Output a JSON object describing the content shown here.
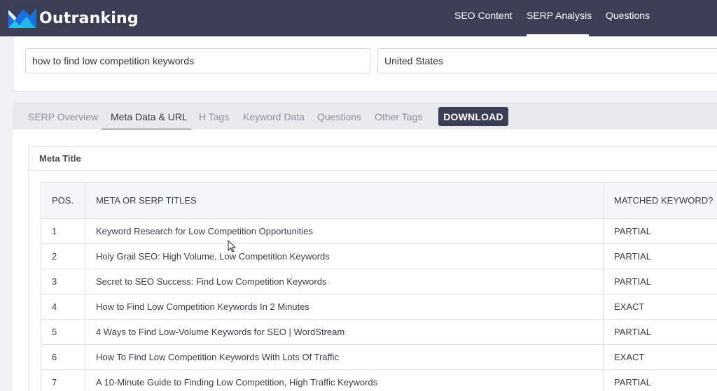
{
  "app": {
    "brand": "Outranking",
    "colors": {
      "header_bg": "#3b3f55",
      "logo_cyan": "#23c4e8",
      "logo_blue": "#1d6fe0"
    }
  },
  "nav": {
    "items": [
      {
        "label": "SEO Content",
        "active": false
      },
      {
        "label": "SERP Analysis",
        "active": true
      },
      {
        "label": "Questions",
        "active": false
      }
    ]
  },
  "search": {
    "keyword_value": "how to find low competition keywords",
    "country_value": "United States"
  },
  "tabs": {
    "items": [
      {
        "label": "SERP Overview",
        "active": false
      },
      {
        "label": "Meta Data & URL",
        "active": true
      },
      {
        "label": "H Tags",
        "active": false
      },
      {
        "label": "Keyword Data",
        "active": false
      },
      {
        "label": "Questions",
        "active": false
      },
      {
        "label": "Other Tags",
        "active": false
      }
    ],
    "download_label": "DOWNLOAD"
  },
  "meta_section": {
    "title": "Meta Title",
    "columns": [
      "POS.",
      "META OR SERP TITLES",
      "MATCHED KEYWORD?"
    ],
    "rows": [
      {
        "pos": "1",
        "title": "Keyword Research for Low Competition Opportunities",
        "match": "PARTIAL"
      },
      {
        "pos": "2",
        "title": "Holy Grail SEO: High Volume, Low Competition Keywords",
        "match": "PARTIAL"
      },
      {
        "pos": "3",
        "title": "Secret to SEO Success: Find Low Competition Keywords",
        "match": "PARTIAL"
      },
      {
        "pos": "4",
        "title": "How to Find Low Competition Keywords In 2 Minutes",
        "match": "EXACT"
      },
      {
        "pos": "5",
        "title": "4 Ways to Find Low-Volume Keywords for SEO | WordStream",
        "match": "PARTIAL"
      },
      {
        "pos": "6",
        "title": "How To Find Low Competition Keywords With Lots Of Traffic",
        "match": "EXACT"
      },
      {
        "pos": "7",
        "title": "A 10-Minute Guide to Finding Low Competition, High Traffic Keywords",
        "match": "PARTIAL"
      }
    ]
  }
}
